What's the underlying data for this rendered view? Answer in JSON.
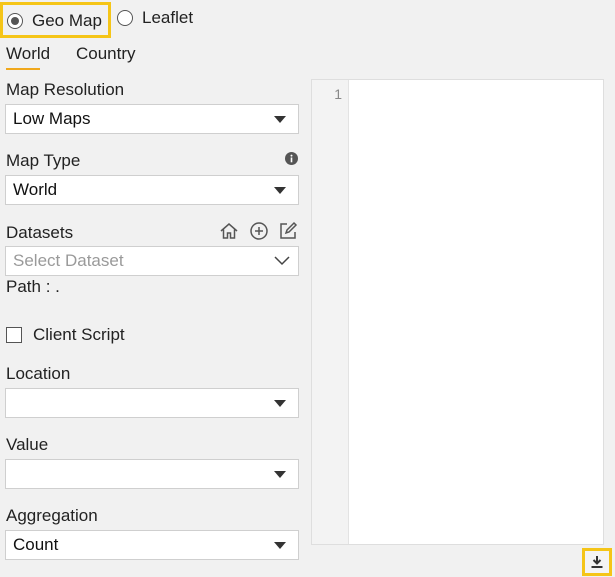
{
  "map_mode": {
    "options": [
      {
        "label": "Geo Map",
        "selected": true
      },
      {
        "label": "Leaflet",
        "selected": false
      }
    ]
  },
  "tabs": [
    {
      "label": "World",
      "active": true
    },
    {
      "label": "Country",
      "active": false
    }
  ],
  "form": {
    "map_resolution": {
      "label": "Map Resolution",
      "value": "Low Maps"
    },
    "map_type": {
      "label": "Map Type",
      "value": "World"
    },
    "datasets": {
      "label": "Datasets",
      "placeholder": "Select Dataset",
      "path_label": "Path : ."
    },
    "client_script": {
      "label": "Client Script",
      "checked": false
    },
    "location": {
      "label": "Location",
      "value": ""
    },
    "value": {
      "label": "Value",
      "value": ""
    },
    "aggregation": {
      "label": "Aggregation",
      "value": "Count"
    }
  },
  "editor": {
    "line_number": "1"
  },
  "colors": {
    "highlight": "#f5c518",
    "tab_underline": "#f0a81c"
  }
}
